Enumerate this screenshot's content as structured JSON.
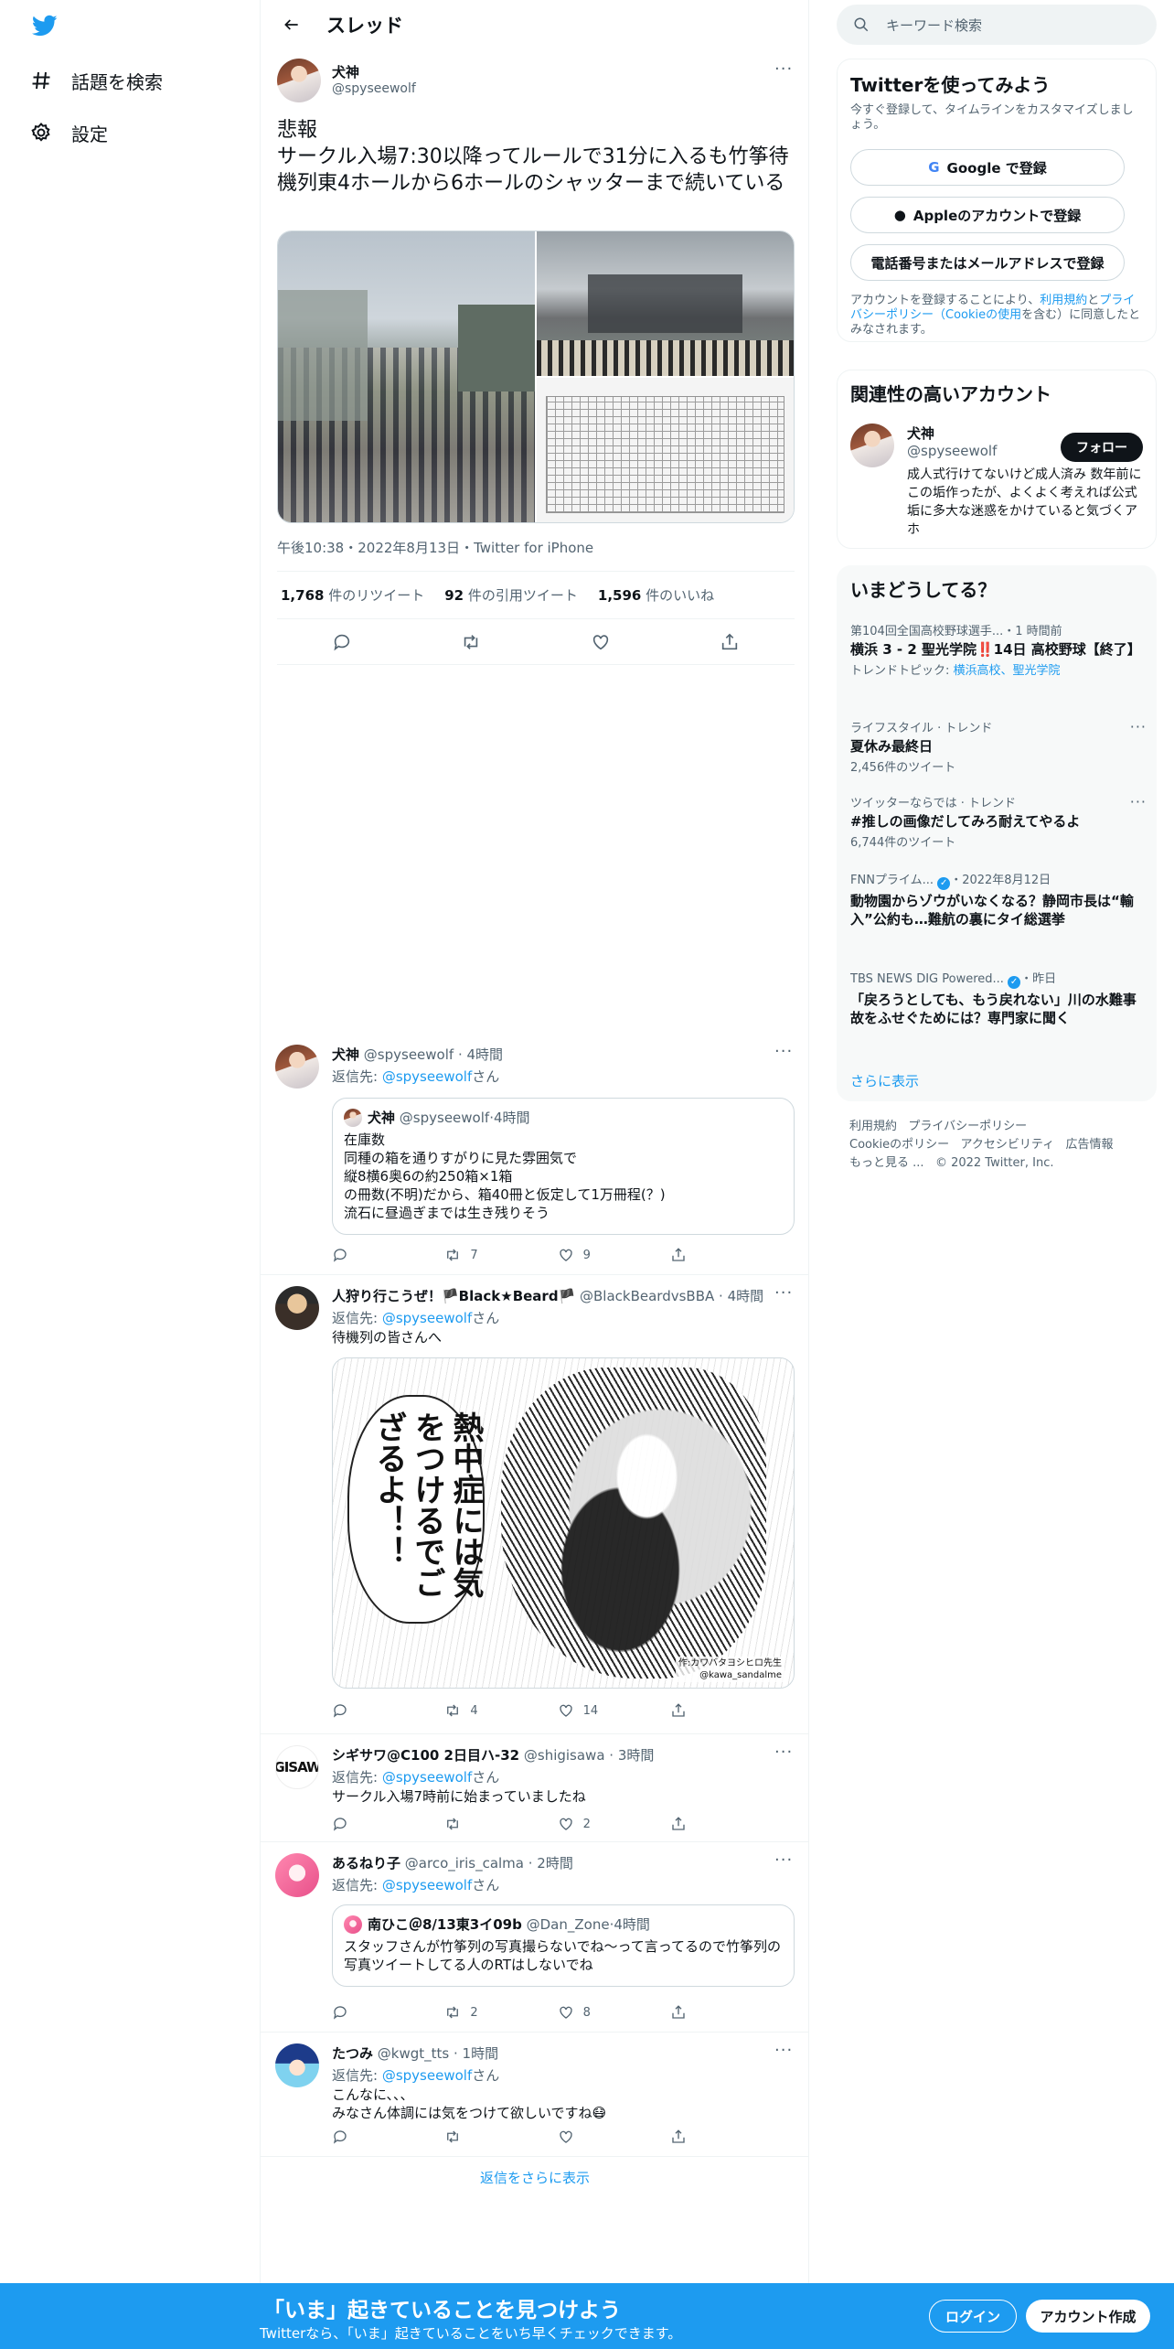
{
  "nav": {
    "items": [
      {
        "label": "話題を検索",
        "icon": "hashtag-icon"
      },
      {
        "label": "設定",
        "icon": "gear-icon"
      }
    ]
  },
  "header": {
    "title": "スレッド"
  },
  "tweet": {
    "name": "犬神",
    "handle": "@spyseewolf",
    "text": "悲報\nサークル入場7:30以降ってルールで31分に入るも竹筝待機列東4ホールから6ホールのシャッターまで続いている",
    "time": "午後10:38",
    "date": "2022年8月13日",
    "client": "Twitter for iPhone",
    "meta_sep": "・",
    "stats": {
      "retweets": "1,768",
      "retweets_label": "件のリツイート",
      "quotes": "92",
      "quotes_label": "件の引用ツイート",
      "likes": "1,596",
      "likes_label": "件のいいね"
    }
  },
  "replies": [
    {
      "name": "犬神",
      "handle": "@spyseewolf",
      "time": "4時間",
      "reply_to_label": "返信先:",
      "reply_to": "@spyseewolf",
      "reply_suffix": "さん",
      "quote": {
        "name": "犬神",
        "handle": "@spyseewolf",
        "time": "4時間",
        "text": "在庫数\n同種の箱を通りすがりに見た雰囲気で\n縦8横6奥6の約250箱×1箱\nの冊数(不明)だから、箱40冊と仮定して1万冊程(？)\n流石に昼過ぎまでは生き残りそう"
      },
      "retweets": "7",
      "likes": "9"
    },
    {
      "name": "人狩り行こうぜ！🏴Black★Beard🏴",
      "handle": "@BlackBeardvsBBA",
      "time": "4時間",
      "reply_to_label": "返信先:",
      "reply_to": "@spyseewolf",
      "reply_suffix": "さん",
      "text": "待機列の皆さんへ",
      "image_text": "熱中症には気をつけるでござるよ！！",
      "image_credit_1": "作:カワバタヨシヒロ先生",
      "image_credit_2": "@kawa_sandalme",
      "retweets": "4",
      "likes": "14"
    },
    {
      "name": "シギサワ@C100 2日目ハ-32",
      "handle": "@shigisawa",
      "time": "3時間",
      "avatar_text": "GISAW",
      "reply_to_label": "返信先:",
      "reply_to": "@spyseewolf",
      "reply_suffix": "さん",
      "text": "サークル入場7時前に始まっていましたね",
      "retweets": "",
      "likes": "2"
    },
    {
      "name": "あるねり子",
      "handle": "@arco_iris_calma",
      "time": "2時間",
      "reply_to_label": "返信先:",
      "reply_to": "@spyseewolf",
      "reply_suffix": "さん",
      "quote": {
        "name": "南ひこ＠8/13東3イ09b",
        "handle": "@Dan_Zone",
        "time": "4時間",
        "text": "スタッフさんが竹筝列の写真撮らないでね～って言ってるので竹筝列の写真ツイートしてる人のRTはしないでね"
      },
      "retweets": "2",
      "likes": "8"
    },
    {
      "name": "たつみ",
      "handle": "@kwgt_tts",
      "time": "1時間",
      "reply_to_label": "返信先:",
      "reply_to": "@spyseewolf",
      "reply_suffix": "さん",
      "text": "こんなに、、、\nみなさん体調には気をつけて欲しいですね😷",
      "retweets": "",
      "likes": ""
    }
  ],
  "show_more_replies": "返信をさらに表示",
  "sidebar": {
    "search_placeholder": "キーワード検索",
    "signup_card": {
      "title": "Twitterを使ってみよう",
      "subtitle": "今すぐ登録して、タイムラインをカスタマイズしましょう。",
      "google": "Google で登録",
      "apple": "Appleのアカウントで登録",
      "phone": "電話番号またはメールアドレスで登録",
      "terms_prefix": "アカウントを登録することにより、",
      "terms_link1": "利用規約",
      "terms_mid": "と",
      "terms_link2": "プライバシーポリシー（Cookieの使用",
      "terms_suffix": "を含む）に同意したとみなされます。"
    },
    "relevant": {
      "title": "関連性の高いアカウント",
      "name": "犬神",
      "handle": "@spyseewolf",
      "follow": "フォロー",
      "bio": "成人式行けてないけど成人済み 数年前にこの垢作ったが、よくよく考えれば公式垢に多大な迷惑をかけていると気づくアホ"
    },
    "trends_title": "いまどうしてる？",
    "trends": [
      {
        "meta": "第104回全国高校野球選手...",
        "meta2": "・1 時間前",
        "title": "横浜 3 - 2 聖光学院‼️14日 高校野球【終了】",
        "sub_label": "トレンドトピック:",
        "sub_links": "横浜高校、聖光学院"
      },
      {
        "meta": "ライフスタイル · トレンド",
        "title": "夏休み最終日",
        "sub": "2,456件のツイート"
      },
      {
        "meta": "ツイッターならでは · トレンド",
        "title": "#推しの画像だしてみろ耐えてやるよ",
        "sub": "6,744件のツイート"
      },
      {
        "meta": "FNNプライム...",
        "meta2": "・2022年8月12日",
        "title": "動物園からゾウがいなくなる？静岡市長は“輸入”公約も…難航の裏にタイ総選挙"
      },
      {
        "meta": "TBS NEWS DIG Powered...",
        "meta2": "・昨日",
        "title": "「戻ろうとしても、もう戻れない」川の水難事故をふせぐためには？専門家に聞く"
      }
    ],
    "show_more": "さらに表示",
    "footer": [
      "利用規約",
      "プライバシーポリシー",
      "Cookieのポリシー",
      "アクセシビリティ",
      "広告情報",
      "もっと見る ...",
      "© 2022 Twitter, Inc."
    ]
  },
  "bottom_bar": {
    "title": "「いま」起きていることを見つけよう",
    "subtitle": "Twitterなら、「いま」起きていることをいち早くチェックできます。",
    "login": "ログイン",
    "signup": "アカウント作成"
  },
  "colors": {
    "accent": "#1d9bf0",
    "text": "#0f1419",
    "muted": "#536471"
  }
}
